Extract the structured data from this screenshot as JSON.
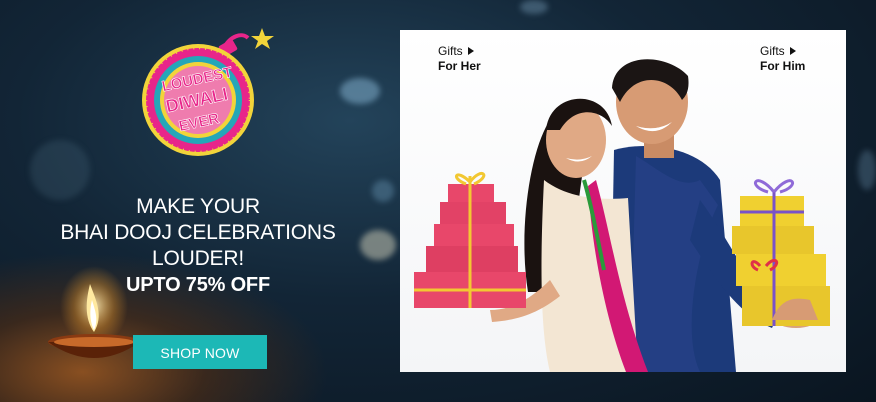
{
  "logo": {
    "text_lines": [
      "LOUDEST",
      "DIWALI",
      "EVER"
    ]
  },
  "headline": {
    "line1": "MAKE YOUR",
    "line2": "BHAI DOOJ CELEBRATIONS",
    "line3": "LOUDER!",
    "offer": "UPTO 75% OFF"
  },
  "cta": {
    "label": "SHOP NOW"
  },
  "gift_links": [
    {
      "label": "Gifts",
      "target": "For Her"
    },
    {
      "label": "Gifts",
      "target": "For Him"
    }
  ],
  "colors": {
    "accent_button": "#1cb8b6",
    "logo_pink": "#e8258a",
    "logo_yellow": "#f2d43a",
    "logo_teal": "#25a6b8",
    "background_dark": "#122536"
  }
}
